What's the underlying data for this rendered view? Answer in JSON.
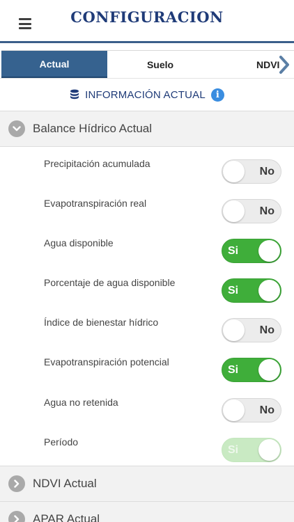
{
  "header": {
    "title": "CONFIGURACION",
    "menu_icon": "hamburger-menu-icon"
  },
  "tabs": [
    {
      "label": "Actual",
      "active": true
    },
    {
      "label": "Suelo",
      "active": false
    },
    {
      "label": "NDVI",
      "active": false
    }
  ],
  "info": {
    "text": "INFORMACIÓN ACTUAL",
    "database_icon": "database-icon",
    "info_icon_glyph": "i"
  },
  "sections": [
    {
      "label": "Balance Hídrico Actual",
      "expanded": true
    },
    {
      "label": "NDVI Actual",
      "expanded": false
    },
    {
      "label": "APAR Actual",
      "expanded": false
    }
  ],
  "settings": [
    {
      "label": "Precipitación acumulada",
      "state": "No",
      "on": false,
      "disabled": false
    },
    {
      "label": "Evapotranspiración real",
      "state": "No",
      "on": false,
      "disabled": false
    },
    {
      "label": "Agua disponible",
      "state": "Si",
      "on": true,
      "disabled": false
    },
    {
      "label": "Porcentaje de agua disponible",
      "state": "Si",
      "on": true,
      "disabled": false
    },
    {
      "label": "Índice de bienestar hídrico",
      "state": "No",
      "on": false,
      "disabled": false
    },
    {
      "label": "Evapotranspiración potencial",
      "state": "Si",
      "on": true,
      "disabled": false
    },
    {
      "label": "Agua no retenida",
      "state": "No",
      "on": false,
      "disabled": false
    },
    {
      "label": "Período",
      "state": "Si",
      "on": true,
      "disabled": true
    }
  ],
  "colors": {
    "accent": "#36628f",
    "title": "#1f3b78",
    "toggle_on": "#3fae3a",
    "toggle_disabled": "#c9eac3",
    "section_bg": "#f2f2f2"
  }
}
